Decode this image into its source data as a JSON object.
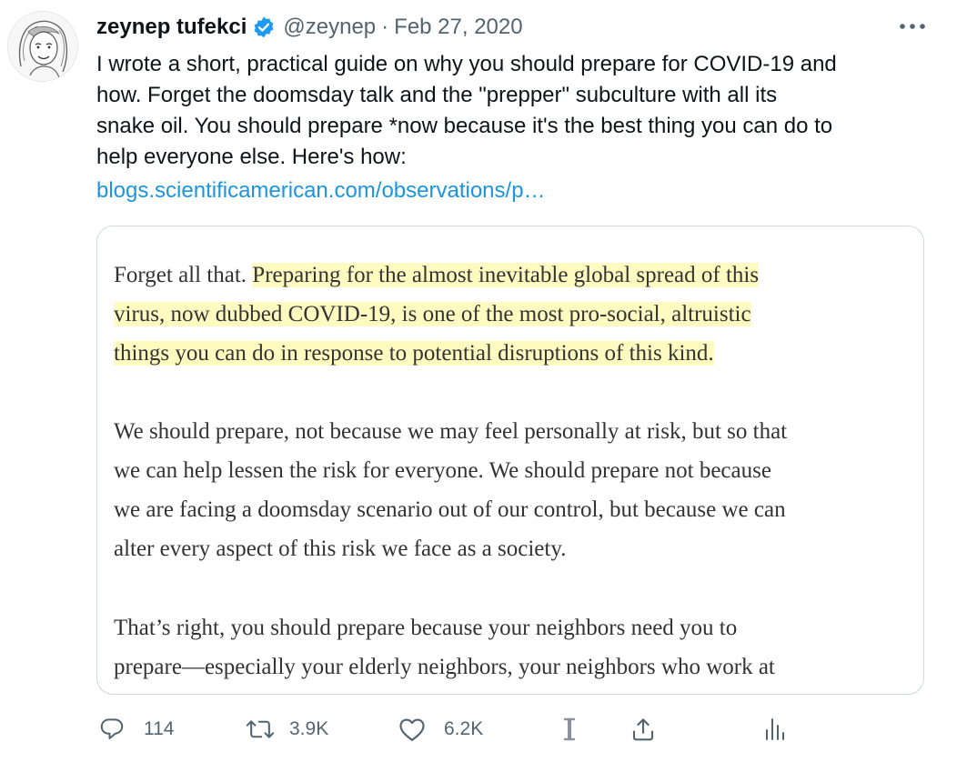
{
  "author": {
    "name": "zeynep tufekci",
    "handle": "@zeynep",
    "separator": "·",
    "date": "Feb 27, 2020",
    "verified_color": "#1d9bf0"
  },
  "tweet": {
    "lines": [
      "I wrote a short, practical guide on why you should prepare for COVID-19 and",
      "how. Forget the doomsday talk and the \"prepper\" subculture with all its",
      "snake oil. You should prepare *now because it's the best thing you can do to",
      "help everyone else. Here's how:"
    ],
    "link": "blogs.scientificamerican.com/observations/p…"
  },
  "card": {
    "paragraph1": {
      "intro": "Forget all that. ",
      "highlight_line1": "Preparing for the almost inevitable global spread of this",
      "highlight_line2": "virus, now dubbed COVID-19, is one of the most pro-social, altruistic",
      "highlight_line3": "things you can do in response to potential disruptions of this kind."
    },
    "paragraph2": [
      "We should prepare, not because we may feel personally at risk, but so that",
      "we can help lessen the risk for everyone. We should prepare not because",
      "we are facing a doomsday scenario out of our control, but because we can",
      "alter every aspect of this risk we face as a society."
    ],
    "paragraph3": [
      "That’s right, you should prepare because your neighbors need you to",
      "prepare—especially your elderly neighbors, your neighbors who work at"
    ],
    "highlight_color": "#fffbc0"
  },
  "actions": {
    "replies": "114",
    "retweets": "3.9K",
    "likes": "6.2K"
  },
  "icons": {
    "more": "more-options-icon",
    "reply": "reply-icon",
    "retweet": "retweet-icon",
    "like": "heart-icon",
    "instapaper": "instapaper-icon",
    "share": "share-icon",
    "analytics": "analytics-icon"
  }
}
